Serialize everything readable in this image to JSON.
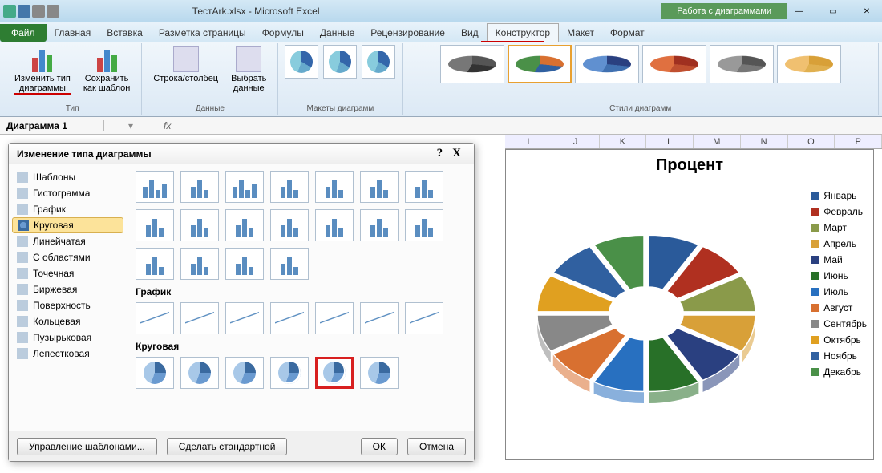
{
  "app_title": "ТестArk.xlsx - Microsoft Excel",
  "chart_tools_label": "Работа с диаграммами",
  "tabs": {
    "file": "Файл",
    "home": "Главная",
    "insert": "Вставка",
    "layout": "Разметка страницы",
    "formulas": "Формулы",
    "data": "Данные",
    "review": "Рецензирование",
    "view": "Вид",
    "constructor": "Конструктор",
    "maket": "Макет",
    "format": "Формат"
  },
  "ribbon": {
    "change_type": "Изменить тип\nдиаграммы",
    "save_template": "Сохранить\nкак шаблон",
    "row_col": "Строка/столбец",
    "select_data": "Выбрать\nданные",
    "group_type": "Тип",
    "group_data": "Данные",
    "group_layouts": "Макеты диаграмм",
    "group_styles": "Стили диаграмм"
  },
  "name_box": "Диаграмма 1",
  "fx": "fx",
  "columns": [
    "I",
    "J",
    "K",
    "L",
    "M",
    "N",
    "O",
    "P"
  ],
  "dialog": {
    "title": "Изменение типа диаграммы",
    "help": "?",
    "close": "X",
    "sidebar": [
      "Шаблоны",
      "Гистограмма",
      "График",
      "Круговая",
      "Линейчатая",
      "С областями",
      "Точечная",
      "Биржевая",
      "Поверхность",
      "Кольцевая",
      "Пузырьковая",
      "Лепестковая"
    ],
    "selected_sidebar": 3,
    "section_line": "График",
    "section_pie": "Круговая",
    "manage_templates": "Управление шаблонами...",
    "set_default": "Сделать стандартной",
    "ok": "ОК",
    "cancel": "Отмена"
  },
  "chart": {
    "title": "Процент",
    "legend": [
      "Январь",
      "Февраль",
      "Март",
      "Апрель",
      "Май",
      "Июнь",
      "Июль",
      "Август",
      "Сентябрь",
      "Октябрь",
      "Ноябрь",
      "Декабрь"
    ],
    "colors": [
      "#2a5a9a",
      "#b03020",
      "#8a9a4a",
      "#d8a038",
      "#2a4080",
      "#287028",
      "#2870c0",
      "#d87030",
      "#888888",
      "#e0a020",
      "#3060a0",
      "#4a9048"
    ]
  },
  "chart_data": {
    "type": "pie",
    "title": "Процент",
    "categories": [
      "Январь",
      "Февраль",
      "Март",
      "Апрель",
      "Май",
      "Июнь",
      "Июль",
      "Август",
      "Сентябрь",
      "Октябрь",
      "Ноябрь",
      "Декабрь"
    ],
    "values": [
      8.3,
      8.3,
      8.3,
      8.3,
      8.3,
      8.3,
      8.3,
      8.3,
      8.3,
      8.3,
      8.3,
      8.3
    ],
    "colors": [
      "#2a5a9a",
      "#b03020",
      "#8a9a4a",
      "#d8a038",
      "#2a4080",
      "#287028",
      "#2870c0",
      "#d87030",
      "#888888",
      "#e0a020",
      "#3060a0",
      "#4a9048"
    ],
    "exploded": true,
    "style_3d": true
  }
}
